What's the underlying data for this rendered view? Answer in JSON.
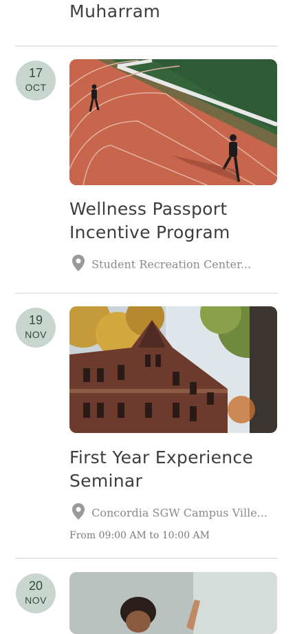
{
  "previous_event": {
    "title": "Muharram"
  },
  "events": [
    {
      "day": "17",
      "month": "OCT",
      "image_icon": "running-track-photo",
      "title_line1": "Wellness Passport",
      "title_line2": "Incentive Program",
      "location": "Student Recreation Center..."
    },
    {
      "day": "19",
      "month": "NOV",
      "image_icon": "campus-building-photo",
      "title_line1": "First Year Experience",
      "title_line2": "Seminar",
      "location": "Concordia SGW Campus Ville...",
      "time": "From 09:00 AM to 10:00 AM"
    },
    {
      "day": "20",
      "month": "NOV",
      "image_icon": "yoga-class-photo"
    }
  ],
  "colors": {
    "badge_bg": "#c9d6cf",
    "badge_text": "#2f4a3d",
    "muted_text": "#8a8a8a"
  }
}
